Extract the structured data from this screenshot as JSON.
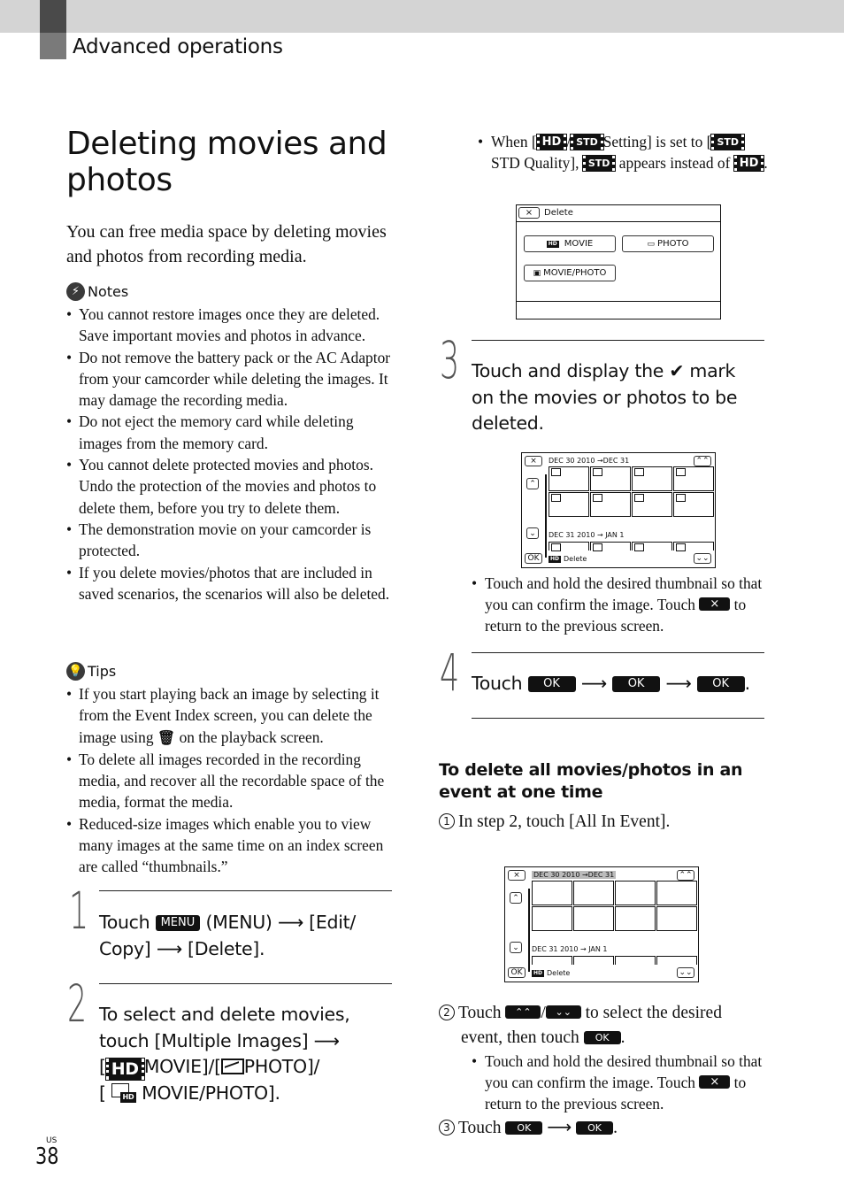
{
  "header": {
    "section": "Advanced operations"
  },
  "title": "Deleting movies and photos",
  "intro": "You can free media space by deleting movies and photos from recording media.",
  "notes": {
    "heading": "Notes",
    "icon": "notes-bolt-icon",
    "items": [
      "You cannot restore images once they are deleted. Save important movies and photos in advance.",
      "Do not remove the battery pack or the AC Adaptor from your camcorder while deleting the images. It may damage the recording media.",
      "Do not eject the memory card while deleting images from the memory card.",
      "You cannot delete protected movies and photos. Undo the protection of the movies and photos to delete them, before you try to delete them.",
      "The demonstration movie on your camcorder is protected.",
      "If you delete movies/photos that are included in saved scenarios, the scenarios will also be deleted."
    ]
  },
  "tips": {
    "heading": "Tips",
    "icon": "tips-bulb-icon",
    "item1_before": "If you start playing back an image by selecting it from the Event Index screen, you can delete the image using",
    "item1_after": "on the playback screen.",
    "trash_glyph": "🗑",
    "items": [
      "To delete all images recorded in the recording media, and recover all the recordable space of the media, format the media.",
      "Reduced-size images which enable you to view many images at the same time on an index screen are called “thumbnails.”"
    ]
  },
  "steps": {
    "s1": {
      "num": "1",
      "t1": "Touch",
      "key": "MENU",
      "t2": "(MENU)",
      "arrow": "⟶",
      "t3": "[Edit/",
      "t4": "Copy]",
      "t5": "[Delete]."
    },
    "s2": {
      "num": "2",
      "l1": "To select and delete movies,",
      "l2": "touch [Multiple Images]",
      "arrow": "⟶",
      "hd": "HD",
      "movie": "MOVIE]/[",
      "photo": "PHOTO]/",
      "open": "[",
      "mp": "MOVIE/PHOTO].",
      "mp_hd": "HD"
    },
    "s3": {
      "num": "3",
      "l1a": "Touch and display the",
      "check": "✔",
      "l1b": "mark",
      "l2": "on the movies or photos to be",
      "l3": "deleted."
    },
    "s4": {
      "num": "4",
      "touch": "Touch",
      "ok": "OK",
      "arrow": "⟶",
      "end": "."
    }
  },
  "hd_note": {
    "p1": "When [",
    "hd": "HD",
    "slash": "/",
    "std": "STD",
    "p2": "Setting] is set to",
    "p3": "[",
    "p4": "STD Quality],",
    "p5": "appears",
    "p6": "instead of",
    "p7": "."
  },
  "screen_delete": {
    "close": "×",
    "title": "Delete",
    "movie": "MOVIE",
    "movie_badge": "HD",
    "photo": "PHOTO",
    "movie_photo": "MOVIE/PHOTO"
  },
  "screen_index": {
    "close": "×",
    "event1": "DEC 30 2010 →DEC 31",
    "event2": "DEC 31 2010 → JAN 1",
    "up": "⌃",
    "down": "⌄",
    "prev_event": "⌃⌃",
    "next_event": "⌄⌄",
    "ok": "OK",
    "badge": "HD",
    "delete": "Delete"
  },
  "step3_note": {
    "l1": "Touch and hold the desired thumbnail so that you can confirm the image. Touch",
    "key": "×",
    "l2": "to return to the previous screen."
  },
  "all_event": {
    "heading": "To delete all movies/photos in an event at one time",
    "s1_num": "1",
    "s1": "In step 2, touch [All In Event].",
    "s2_num": "2",
    "s2a": "Touch",
    "up_key": "⌃⌃",
    "slash": "/",
    "down_key": "⌄⌄",
    "s2b": "to select the desired",
    "s2c": "event, then touch",
    "ok": "OK",
    "s2d": ".",
    "note_l1": "Touch and hold the desired thumbnail so that you can confirm the image. Touch",
    "note_key": "×",
    "note_l2": "to return to the previous screen.",
    "s3_num": "3",
    "s3": "Touch",
    "arrow": "⟶",
    "s3_end": "."
  },
  "footer": {
    "lang": "US",
    "page": "38"
  }
}
